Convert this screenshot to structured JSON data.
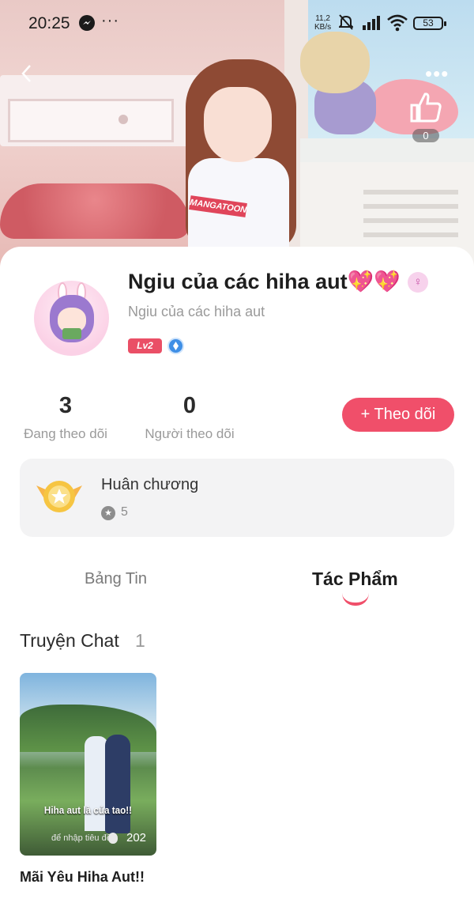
{
  "status_bar": {
    "time": "20:25",
    "more": "···",
    "net_speed_value": "11,2",
    "net_speed_unit": "KB/s",
    "battery": "53"
  },
  "header": {
    "back_icon": "chevron-left-icon",
    "more": "•••",
    "like_count": "0",
    "shirt_text": "MANGATOON"
  },
  "profile": {
    "name": "Ngiu của các hiha aut💖💖",
    "gender_symbol": "♀",
    "subtitle": "Ngiu của các hiha aut",
    "level": "Lv2"
  },
  "stats": [
    {
      "value": "3",
      "label": "Đang theo dõi"
    },
    {
      "value": "0",
      "label": "Người theo dõi"
    }
  ],
  "follow_button": {
    "label": "+ Theo dõi"
  },
  "medal": {
    "title": "Huân chương",
    "count": "5"
  },
  "tabs": [
    {
      "label": "Bảng Tin",
      "active": false
    },
    {
      "label": "Tác Phẩm",
      "active": true
    }
  ],
  "section": {
    "title": "Truyện Chat",
    "count": "1"
  },
  "works": [
    {
      "cover_text": "Hiha aut là của tao!!",
      "cover_sub": "để nhập tiêu đề",
      "views": "202",
      "title": "Mãi Yêu Hiha Aut!!"
    }
  ],
  "colors": {
    "accent": "#f04f6a",
    "card_bg": "#f3f3f4",
    "muted": "#9a9a9a"
  }
}
